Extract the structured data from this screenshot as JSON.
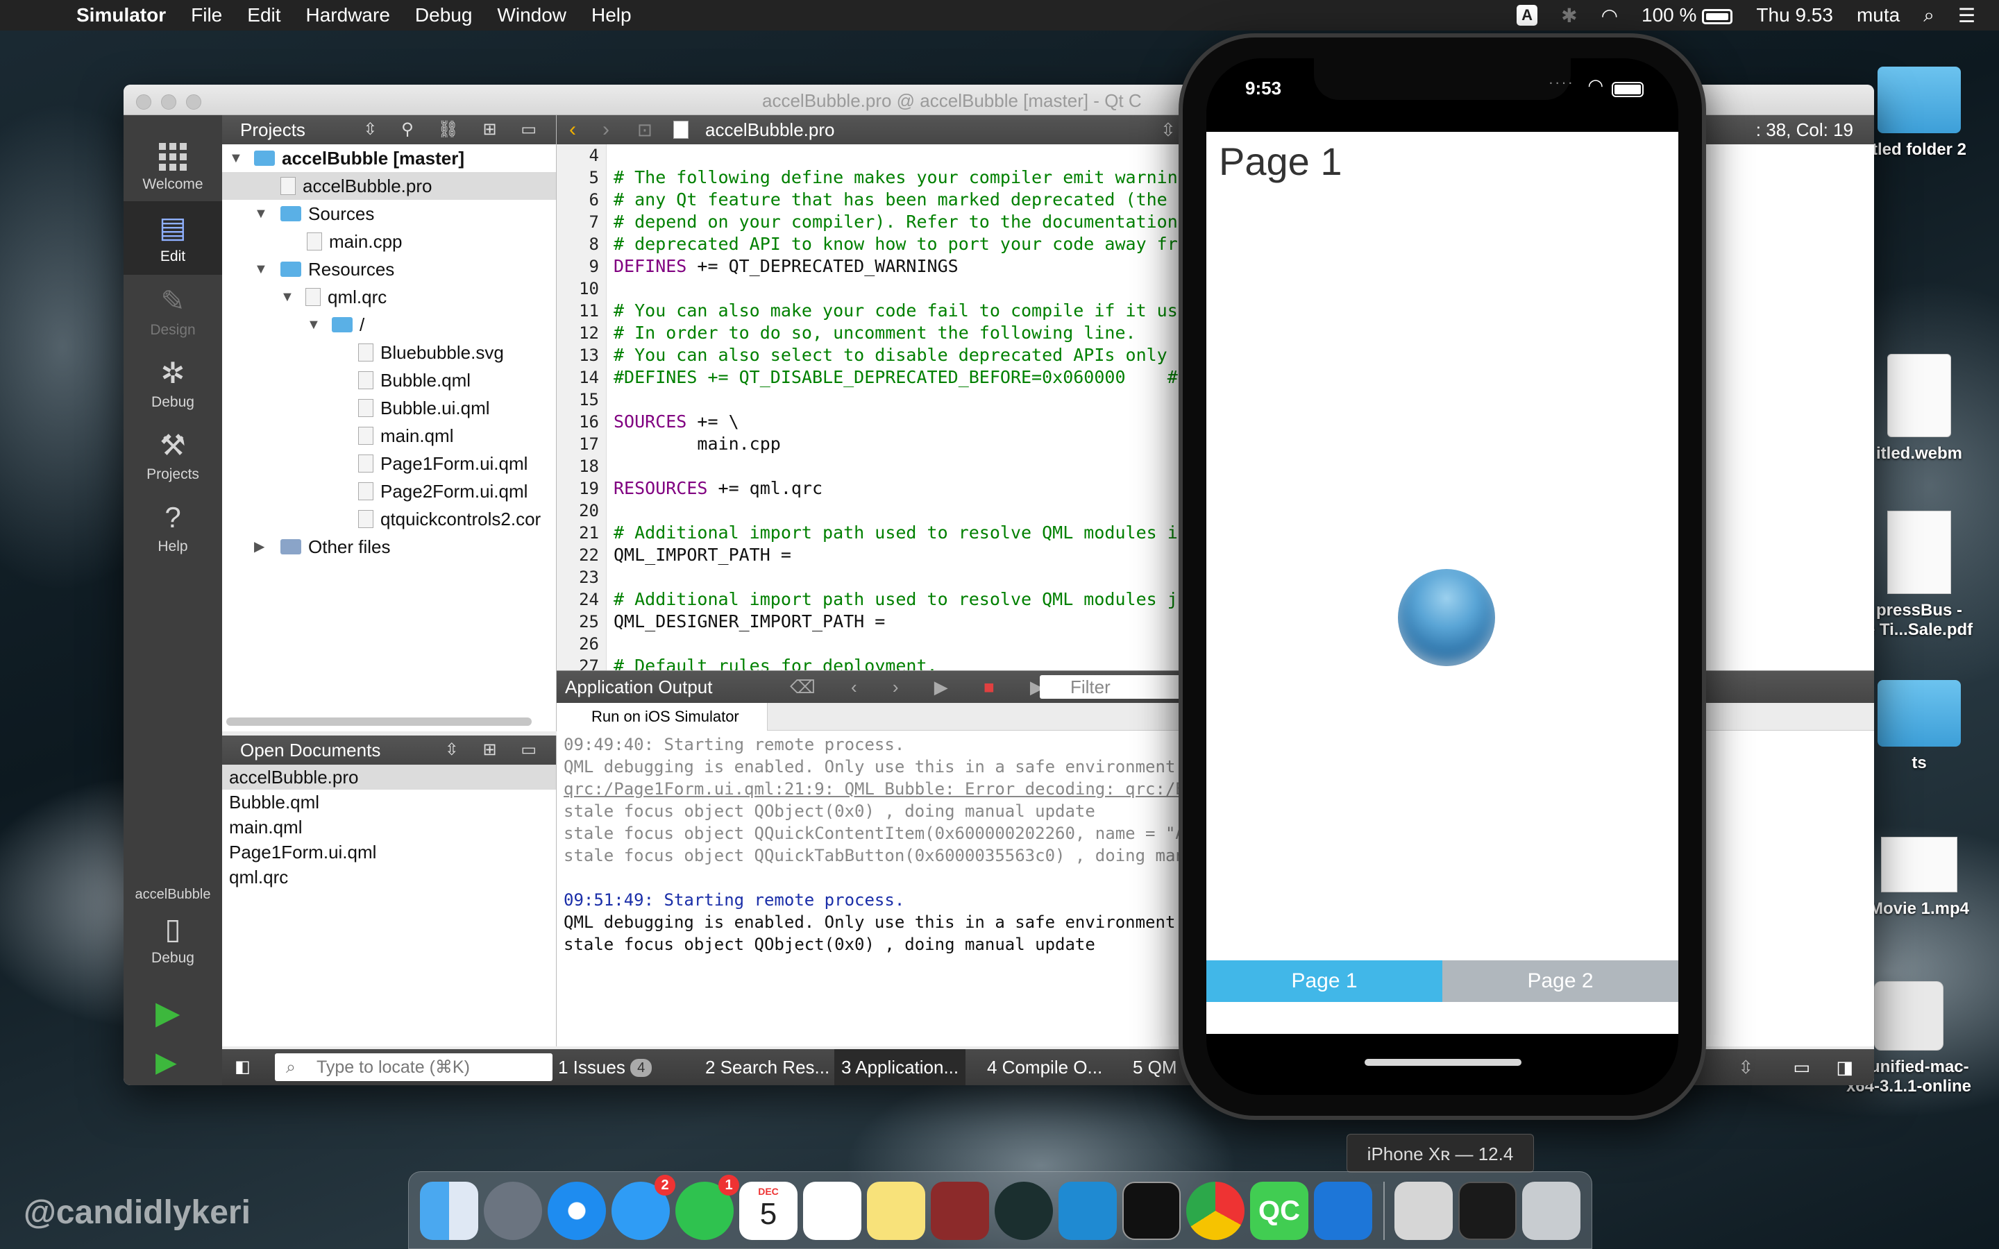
{
  "menubar": {
    "apple": "",
    "app_name": "Simulator",
    "items": [
      "File",
      "Edit",
      "Hardware",
      "Debug",
      "Window",
      "Help"
    ],
    "input_indicator": "A",
    "battery": "100 %",
    "clock": "Thu 9.53",
    "user": "muta"
  },
  "qt": {
    "window_title": "accelBubble.pro @ accelBubble [master] - Qt C",
    "modes": [
      "Welcome",
      "Edit",
      "Design",
      "Debug",
      "Projects",
      "Help"
    ],
    "kit_label": "accelBubble",
    "kit_mode": "Debug",
    "projects_header": "Projects",
    "tree": {
      "root": "accelBubble [master]",
      "pro_file": "accelBubble.pro",
      "sources": "Sources",
      "main_cpp": "main.cpp",
      "resources": "Resources",
      "qrc": "qml.qrc",
      "slash": "/",
      "files": [
        "Bluebubble.svg",
        "Bubble.qml",
        "Bubble.ui.qml",
        "main.qml",
        "Page1Form.ui.qml",
        "Page2Form.ui.qml",
        "qtquickcontrols2.cor"
      ],
      "other": "Other files"
    },
    "open_docs_header": "Open Documents",
    "open_docs": [
      "accelBubble.pro",
      "Bubble.qml",
      "main.qml",
      "Page1Form.ui.qml",
      "qml.qrc"
    ],
    "editor": {
      "file": "accelBubble.pro",
      "position": ": 38, Col: 19",
      "line_numbers": [
        "4",
        "5",
        "6",
        "7",
        "8",
        "9",
        "10",
        "11",
        "12",
        "13",
        "14",
        "15",
        "16",
        "17",
        "18",
        "19",
        "20",
        "21",
        "22",
        "23",
        "24",
        "25",
        "26",
        "27"
      ],
      "lines": [
        "",
        "# The following define makes your compiler emit warnings",
        "# any Qt feature that has been marked deprecated (the ex",
        "# depend on your compiler). Refer to the documentation fo",
        "# deprecated API to know how to port your code away from",
        "DEFINES += QT_DEPRECATED_WARNINGS",
        "",
        "# You can also make your code fail to compile if it uses",
        "# In order to do so, uncomment the following line.",
        "# You can also select to disable deprecated APIs only up",
        "#DEFINES += QT_DISABLE_DEPRECATED_BEFORE=0x060000    # d",
        "",
        "SOURCES += \\",
        "        main.cpp",
        "",
        "RESOURCES += qml.qrc",
        "",
        "# Additional import path used to resolve QML modules in Q",
        "QML_IMPORT_PATH =",
        "",
        "# Additional import path used to resolve QML modules just",
        "QML_DESIGNER_IMPORT_PATH =",
        "",
        "# Default rules for deployment."
      ]
    },
    "output": {
      "header": "Application Output",
      "filter_placeholder": "Filter",
      "tab": "Run on iOS Simulator",
      "old_lines": [
        "09:49:40: Starting remote process.",
        "QML debugging is enabled. Only use this in a safe environment.",
        "qrc:/Page1Form.ui.qml:21:9: QML Bubble: Error decoding: qrc:/B",
        "stale focus object QObject(0x0) , doing manual update",
        "stale focus object QQuickContentItem(0x600000202260, name = \"A",
        "stale focus object QQuickTabButton(0x6000035563c0) , doing man"
      ],
      "stamp": "09:51:49: Starting remote process.",
      "new_lines": [
        "QML debugging is enabled. Only use this in a safe environment.",
        "stale focus object QObject(0x0) , doing manual update"
      ]
    },
    "status": {
      "locate_placeholder": "Type to locate (⌘K)",
      "tabs": [
        "1  Issues",
        "2  Search Res...",
        "3  Application...",
        "4  Compile O...",
        "5  QM"
      ],
      "issues_count": "4"
    }
  },
  "desktop": {
    "icons": [
      "tled folder 2",
      "itled.webm",
      "pressBus -\ne Ti...Sale.pdf",
      "ts",
      "Movie 1.mp4",
      "qt-unified-mac-\nx64-3.1.1-online"
    ]
  },
  "simulator": {
    "time": "9:53",
    "page_title": "Page 1",
    "tabs": [
      "Page 1",
      "Page 2"
    ],
    "device_tooltip": "iPhone Xʀ — 12.4"
  },
  "dock": {
    "apps": [
      "finder-icon",
      "launchpad-icon",
      "safari-icon",
      "messages-icon",
      "whatsapp-icon",
      "calendar-icon",
      "reminders-icon",
      "notes-icon",
      "dictionary-icon",
      "gitkraken-icon",
      "vscode-icon",
      "terminal-icon",
      "chrome-icon",
      "qtcreator-icon",
      "xcode-icon",
      "simulator-icon",
      "preview-icon",
      "terminal2-icon",
      "trash-icon"
    ],
    "messages_badge": "2",
    "whatsapp_badge": "1",
    "calendar_month": "DEC",
    "calendar_day": "5",
    "qt_label": "QC"
  },
  "watermark": "@candidlykeri",
  "colors": {
    "accent_blue": "#41b7e8",
    "tab_off": "#b0b7bd",
    "comment_green": "#008000",
    "keyword_purple": "#800080"
  }
}
